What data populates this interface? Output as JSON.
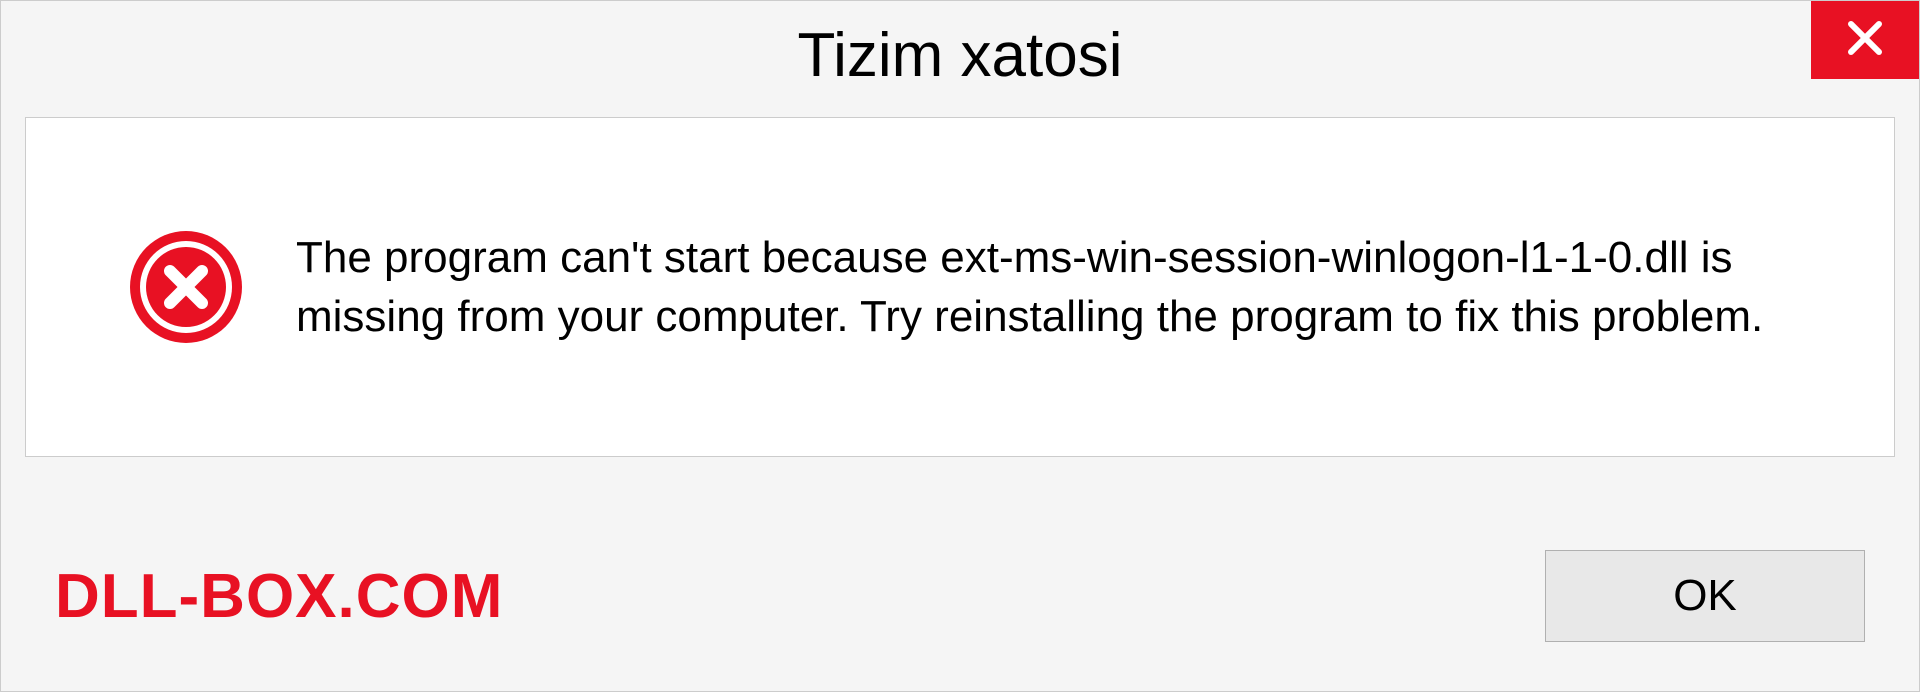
{
  "dialog": {
    "title": "Tizim xatosi",
    "message": "The program can't start because ext-ms-win-session-winlogon-l1-1-0.dll is missing from your computer. Try reinstalling the program to fix this problem.",
    "ok_label": "OK"
  },
  "watermark": "DLL-BOX.COM",
  "colors": {
    "error_red": "#e81123",
    "background": "#f5f5f5",
    "content_bg": "#ffffff"
  }
}
